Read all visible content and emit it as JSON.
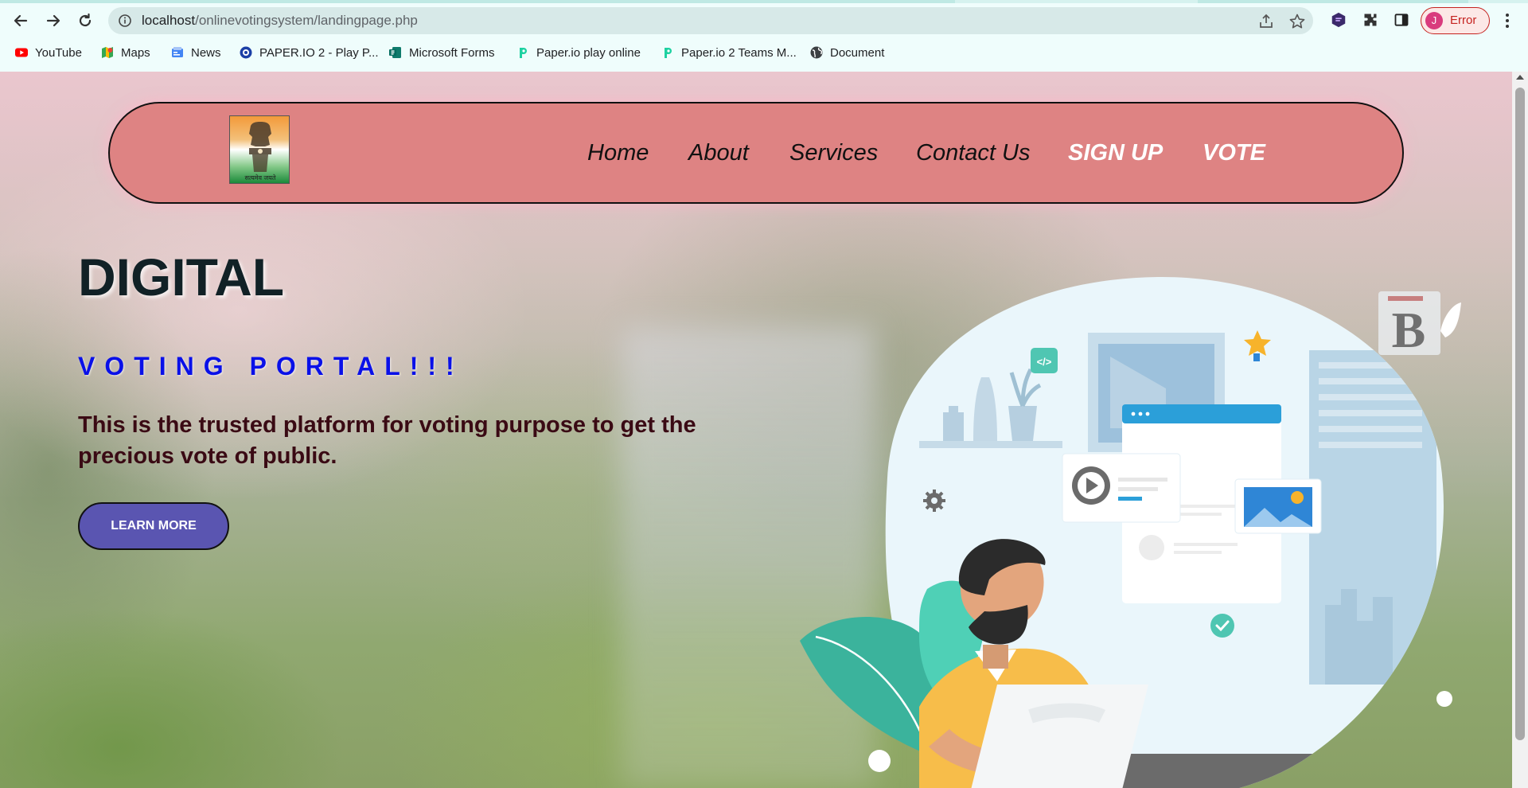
{
  "browser": {
    "url_host": "localhost",
    "url_path": "/onlinevotingsystem/landingpage.php",
    "profile_initial": "J",
    "profile_status": "Error",
    "bookmarks": [
      {
        "label": "YouTube",
        "icon": "youtube-icon"
      },
      {
        "label": "Maps",
        "icon": "maps-icon"
      },
      {
        "label": "News",
        "icon": "news-icon"
      },
      {
        "label": "PAPER.IO 2 - Play P...",
        "icon": "paperio-circle-icon"
      },
      {
        "label": "Microsoft Forms",
        "icon": "forms-icon"
      },
      {
        "label": "Paper.io play online",
        "icon": "paperio-p-icon"
      },
      {
        "label": "Paper.io 2 Teams M...",
        "icon": "paperio-p-icon"
      },
      {
        "label": "Document",
        "icon": "globe-icon"
      }
    ]
  },
  "nav": {
    "emblem_motto": "सत्यमेव जयते",
    "links": [
      "Home",
      "About",
      "Services",
      "Contact Us",
      "SIGN UP",
      "VOTE"
    ]
  },
  "hero": {
    "title": "DIGITAL",
    "subtitle": "VOTING PORTAL!!!",
    "description": "This is the trusted platform for voting purpose to get the precious vote of public.",
    "button": "LEARN MORE"
  },
  "illustration": {
    "code_tag": "</>",
    "logo_letter": "B"
  },
  "colors": {
    "navbar": "#de8383",
    "subtitle": "#0a10e8",
    "description": "#3a0a14",
    "button": "#5a55b1"
  }
}
